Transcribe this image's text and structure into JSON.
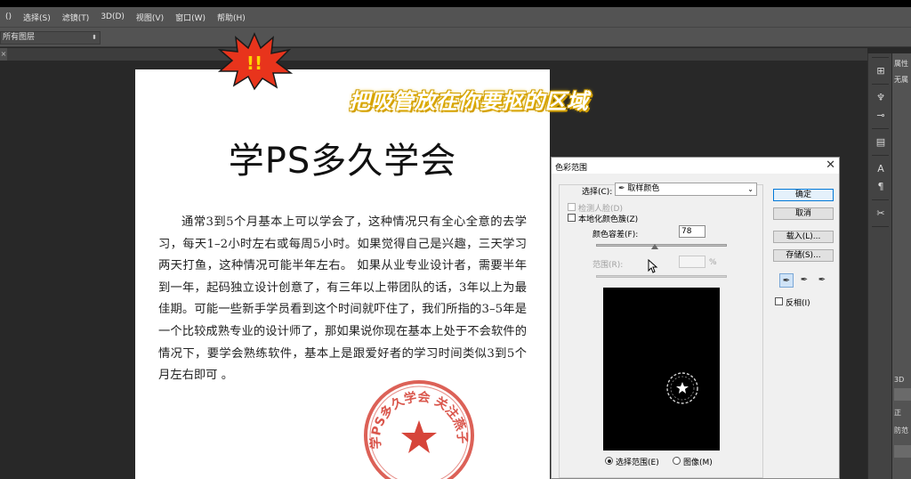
{
  "menubar": {
    "items": [
      "()",
      "选择(S)",
      "滤镜(T)",
      "3D(D)",
      "视图(V)",
      "窗口(W)",
      "帮助(H)"
    ]
  },
  "options_bar": {
    "sample_select": "所有图层"
  },
  "canvas": {
    "title": "学PS多久学会",
    "body": "通常3到5个月基本上可以学会了，这种情况只有全心全意的去学习，每天1–2小时左右或每周5小时。如果觉得自己是兴趣，三天学习两天打鱼，这种情况可能半年左右。 如果从业专业设计者，需要半年到一年，起码独立设计创意了，有三年以上带团队的话，3年以上为最佳期。可能一些新手学员看到这个时间就吓住了，我们所指的3–5年是一个比较成熟专业的设计师了，那如果说你现在基本上处于不会软件的情况下，要学会熟练软件，基本上是跟爱好者的学习时间类似3到5个月左右即可 。",
    "seal_text": "学PS多久学会  关注燕子"
  },
  "overlay": {
    "caption": "把吸管放在你要抠的区域",
    "burst_text": "!!"
  },
  "dialog": {
    "title": "色彩范围",
    "select_label": "选择(C):",
    "select_value": "取样颜色",
    "detect_faces": "检测人脸(D)",
    "localized": "本地化颜色簇(Z)",
    "fuzziness_label": "颜色容差(F):",
    "fuzziness_value": "78",
    "fuzziness_level": 0.45,
    "range_label": "范围(R):",
    "range_unit": "%",
    "radio_selection": "选择范围(E)",
    "radio_image": "图像(M)",
    "buttons": {
      "ok": "确定",
      "cancel": "取消",
      "load": "载入(L)...",
      "save": "存储(S)..."
    },
    "invert": "反相(I)"
  },
  "right_panel": {
    "label_top": "属性",
    "label_none": "无属",
    "label_3d": "3D",
    "label_z": "正",
    "label_r": "防范"
  }
}
